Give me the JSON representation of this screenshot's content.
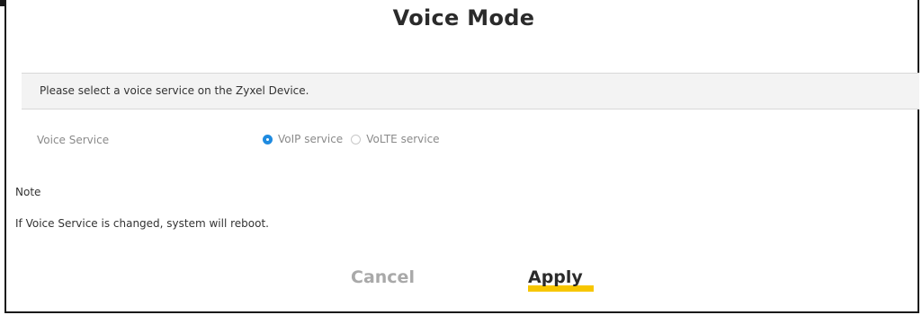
{
  "page": {
    "title": "Voice Mode"
  },
  "info": {
    "message": "Please select a voice service on the Zyxel Device."
  },
  "voice_service": {
    "label": "Voice Service",
    "options": [
      {
        "label": "VoIP service",
        "selected": true
      },
      {
        "label": "VoLTE service",
        "selected": false
      }
    ]
  },
  "note": {
    "title": "Note",
    "text": "If Voice Service is changed, system will reboot."
  },
  "buttons": {
    "cancel_label": "Cancel",
    "apply_label": "Apply"
  },
  "colors": {
    "accent": "#1f8be0",
    "highlight": "#f7c600"
  }
}
